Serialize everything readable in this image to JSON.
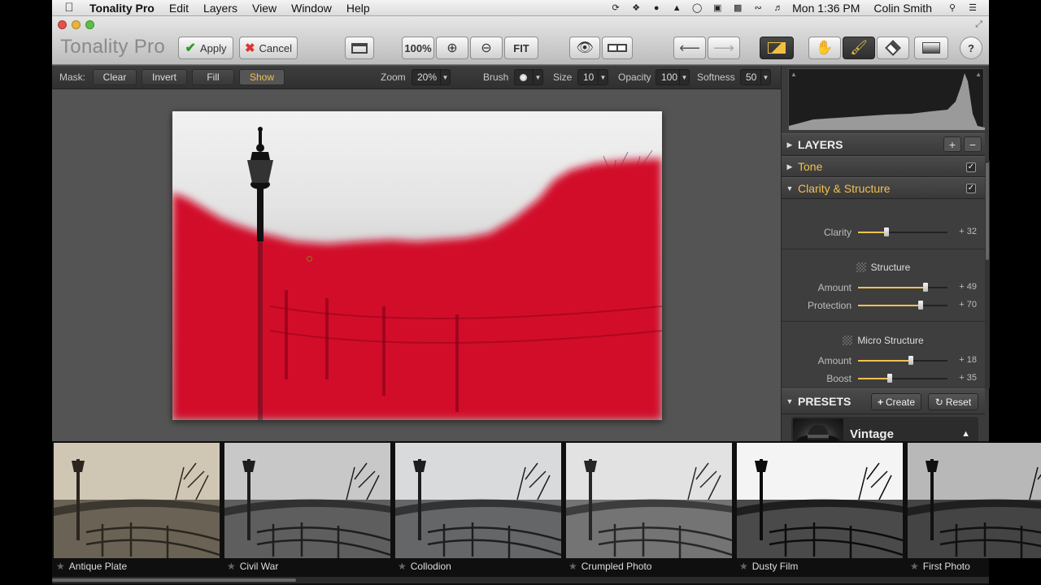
{
  "menubar": {
    "apple_icon": "apple-icon",
    "app_name": "Tonality Pro",
    "menus": [
      "Edit",
      "Layers",
      "View",
      "Window",
      "Help"
    ],
    "clock": "Mon 1:36 PM",
    "user": "Colin Smith"
  },
  "window": {
    "title": "Tonality Pro",
    "apply_label": "Apply",
    "cancel_label": "Cancel",
    "zoom_level": "100%",
    "fit_label": "FIT"
  },
  "mask_bar": {
    "mask_label": "Mask:",
    "clear": "Clear",
    "invert": "Invert",
    "fill": "Fill",
    "show": "Show",
    "zoom_label": "Zoom",
    "zoom_value": "20%",
    "brush_label": "Brush",
    "size_label": "Size",
    "size_value": "10",
    "opacity_label": "Opacity",
    "opacity_value": "100",
    "softness_label": "Softness",
    "softness_value": "50"
  },
  "panel": {
    "layers_title": "LAYERS",
    "tone_label": "Tone",
    "clarity_structure_label": "Clarity & Structure",
    "clarity": {
      "label": "Clarity",
      "value": "+ 32",
      "level": 0.32
    },
    "structure_title": "Structure",
    "structure_amount": {
      "label": "Amount",
      "value": "+ 49",
      "level": 0.75
    },
    "structure_protection": {
      "label": "Protection",
      "value": "+ 70",
      "level": 0.7
    },
    "micro_title": "Micro Structure",
    "micro_amount": {
      "label": "Amount",
      "value": "+ 18",
      "level": 0.59
    },
    "micro_boost": {
      "label": "Boost",
      "value": "+ 35",
      "level": 0.35
    },
    "presets_title": "PRESETS",
    "create_label": "Create",
    "reset_label": "Reset",
    "preset_selected": "Vintage"
  },
  "filmstrip": [
    {
      "name": "Antique Plate",
      "tone": "sepia"
    },
    {
      "name": "Civil War",
      "tone": "gray"
    },
    {
      "name": "Collodion",
      "tone": "cool"
    },
    {
      "name": "Crumpled Photo",
      "tone": "light"
    },
    {
      "name": "Dusty Film",
      "tone": "contrast"
    },
    {
      "name": "First Photo",
      "tone": "dark"
    }
  ],
  "colors": {
    "mask_red": "#d2072a",
    "accent_yellow": "#f2c14e"
  }
}
